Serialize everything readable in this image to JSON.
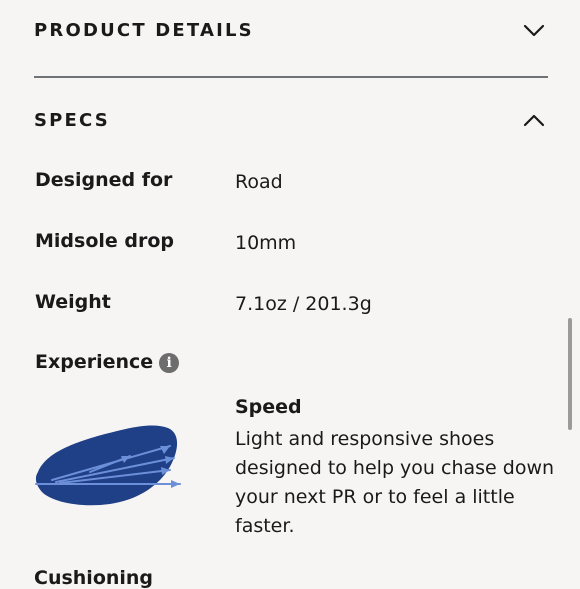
{
  "product_details": {
    "title": "PRODUCT DETAILS",
    "icon": "chevron-down-icon"
  },
  "specs": {
    "title": "SPECS",
    "icon": "chevron-up-icon",
    "rows": [
      {
        "label": "Designed for",
        "value": "Road"
      },
      {
        "label": "Midsole drop",
        "value": "10mm"
      },
      {
        "label": "Weight",
        "value": "7.1oz / 201.3g"
      }
    ],
    "experience": {
      "label": "Experience",
      "info_icon": "info-icon",
      "info_glyph": "i",
      "type": "Speed",
      "description": "Light and responsive shoes designed to help you chase down your next PR or to feel a little faster.",
      "illustration_color": "#1f3f86"
    }
  },
  "next_section": {
    "label": "Cushioning"
  }
}
